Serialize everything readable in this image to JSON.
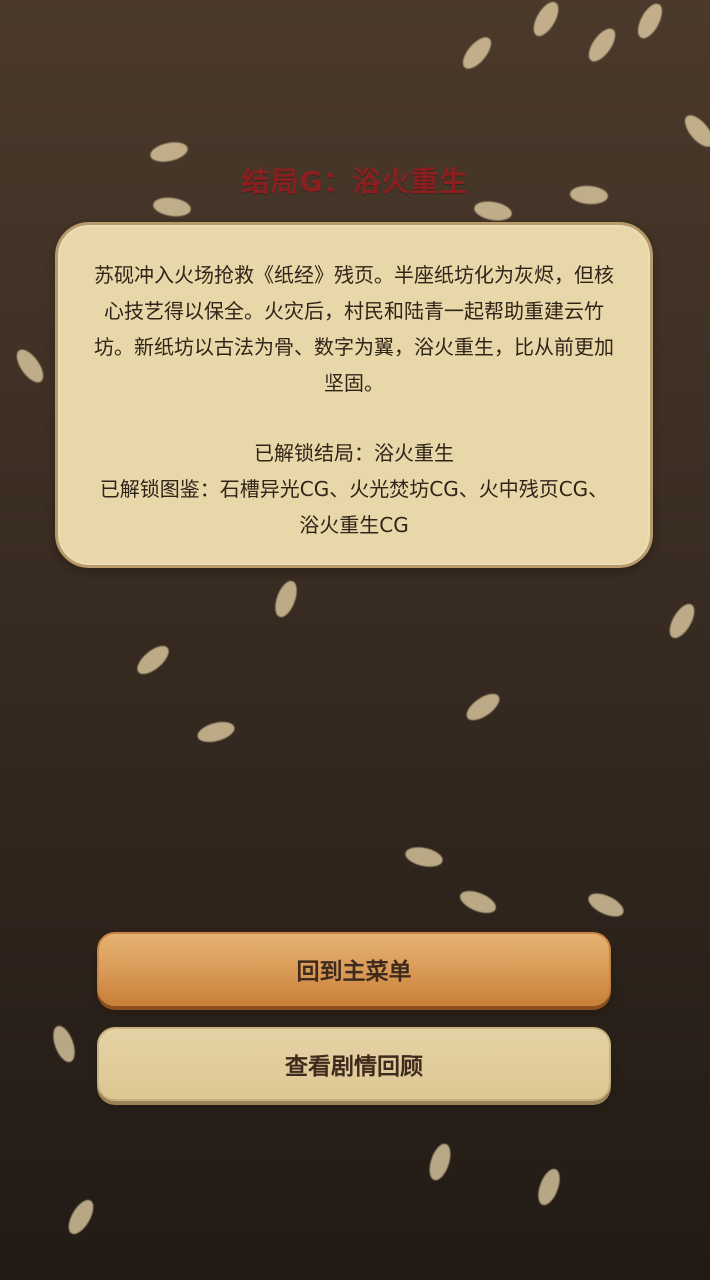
{
  "ending": {
    "title": "结局G：浴火重生",
    "story": "苏砚冲入火场抢救《纸经》残页。半座纸坊化为灰烬，但核心技艺得以保全。火灾后，村民和陆青一起帮助重建云竹坊。新纸坊以古法为骨、数字为翼，浴火重生，比从前更加坚固。",
    "unlocked_ending": "已解锁结局：浴火重生",
    "unlocked_gallery": "已解锁图鉴：石槽异光CG、火光焚坊CG、火中残页CG、浴火重生CG"
  },
  "buttons": {
    "main_menu": "回到主菜单",
    "review_story": "查看剧情回顾"
  },
  "colors": {
    "title": "#8b1f1f",
    "card_bg": "#e8d7a9",
    "button_primary": "#d99956",
    "button_secondary": "#e5d2a4"
  }
}
